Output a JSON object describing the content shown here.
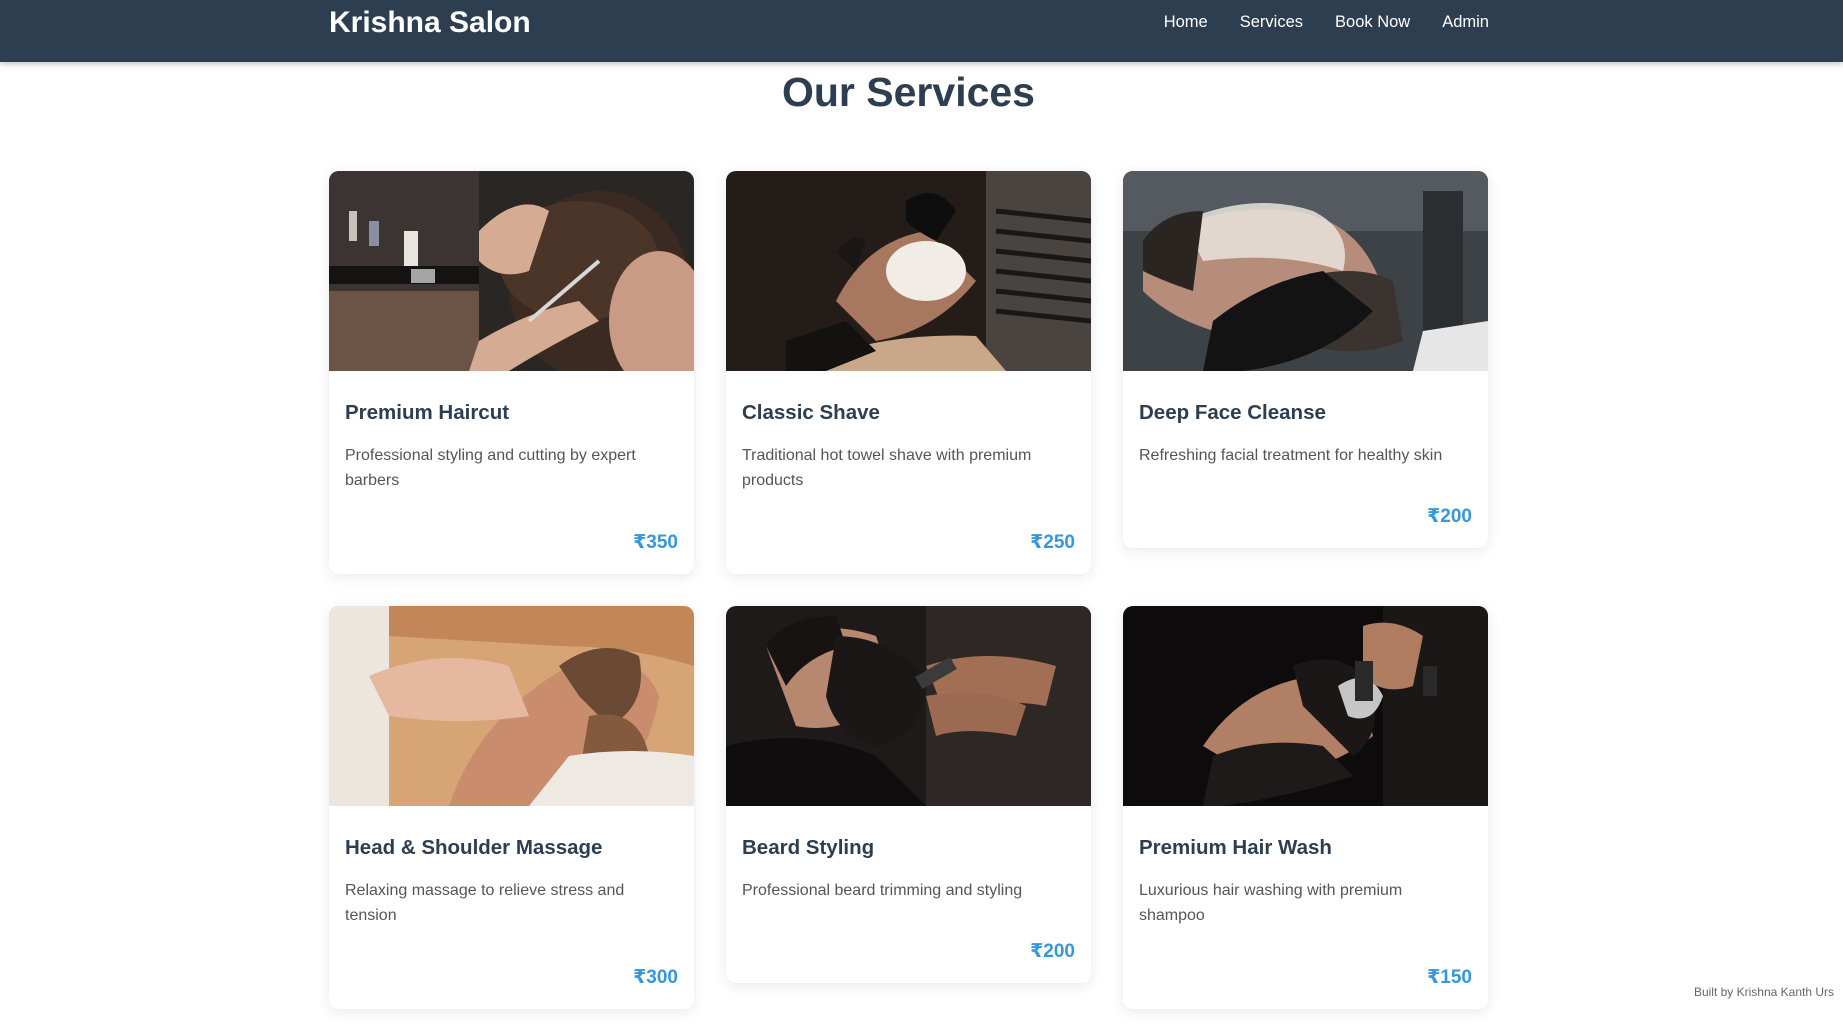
{
  "brand": "Krishna Salon",
  "nav": [
    "Home",
    "Services",
    "Book Now",
    "Admin"
  ],
  "page_title": "Our Services",
  "services": [
    {
      "title": "Premium Haircut",
      "description": "Professional styling and cutting by expert barbers",
      "price": "₹350",
      "image": "haircut-photo"
    },
    {
      "title": "Classic Shave",
      "description": "Traditional hot towel shave with premium products",
      "price": "₹250",
      "image": "shave-photo"
    },
    {
      "title": "Deep Face Cleanse",
      "description": "Refreshing facial treatment for healthy skin",
      "price": "₹200",
      "image": "facial-photo"
    },
    {
      "title": "Head & Shoulder Massage",
      "description": "Relaxing massage to relieve stress and tension",
      "price": "₹300",
      "image": "massage-photo"
    },
    {
      "title": "Beard Styling",
      "description": "Professional beard trimming and styling",
      "price": "₹200",
      "image": "beard-photo"
    },
    {
      "title": "Premium Hair Wash",
      "description": "Luxurious hair washing with premium shampoo",
      "price": "₹150",
      "image": "hairwash-photo"
    }
  ],
  "footer": "Built by Krishna Kanth Urs",
  "colors": {
    "navbar": "#2c3e50",
    "price": "#3498db",
    "title": "#2c3e50"
  }
}
